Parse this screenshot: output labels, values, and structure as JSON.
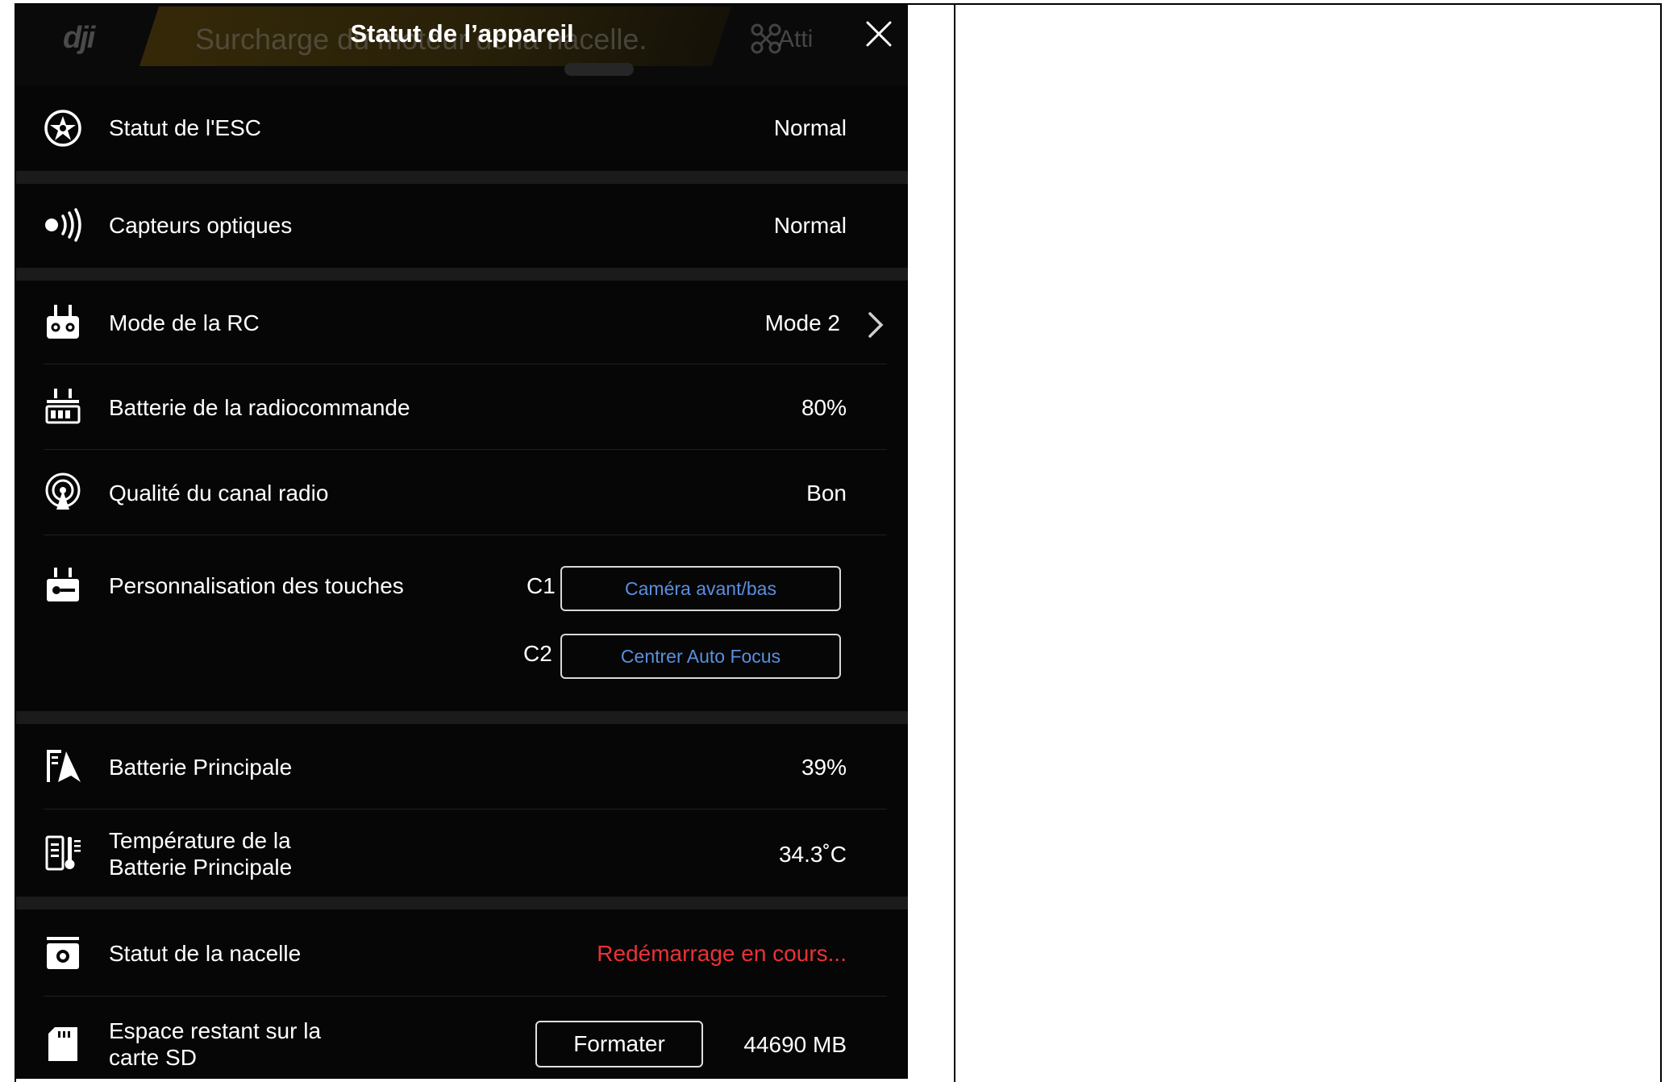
{
  "header": {
    "title": "Statut de l’appareil",
    "bg_warning": "Surcharge du moteur de la nacelle.",
    "bg_logo": "dji",
    "bg_mode": "Atti"
  },
  "rows": {
    "esc": {
      "label": "Statut de l'ESC",
      "value": "Normal"
    },
    "vision": {
      "label": "Capteurs optiques",
      "value": "Normal"
    },
    "rc_mode": {
      "label": "Mode de la RC",
      "value": "Mode 2"
    },
    "rc_battery": {
      "label": "Batterie de la radiocommande",
      "value": "80%"
    },
    "radio": {
      "label": "Qualité du canal radio",
      "value": "Bon"
    },
    "buttons": {
      "label": "Personnalisation des touches",
      "c1_key": "C1",
      "c1_value": "Caméra avant/bas",
      "c2_key": "C2",
      "c2_value": "Centrer Auto Focus"
    },
    "main_battery": {
      "label": "Batterie Principale",
      "value": "39%"
    },
    "battery_temp": {
      "label_line1": "Température de la",
      "label_line2": "Batterie Principale",
      "value": "34.3˚C"
    },
    "gimbal": {
      "label": "Statut de la nacelle",
      "value": "Redémarrage en cours..."
    },
    "sd": {
      "label_line1": "Espace restant sur la",
      "label_line2": "carte SD",
      "format_label": "Formater",
      "value": "44690 MB"
    }
  },
  "colors": {
    "accent_blue": "#5a8fe0",
    "error_red": "#e93238",
    "panel_bg": "#060606"
  }
}
